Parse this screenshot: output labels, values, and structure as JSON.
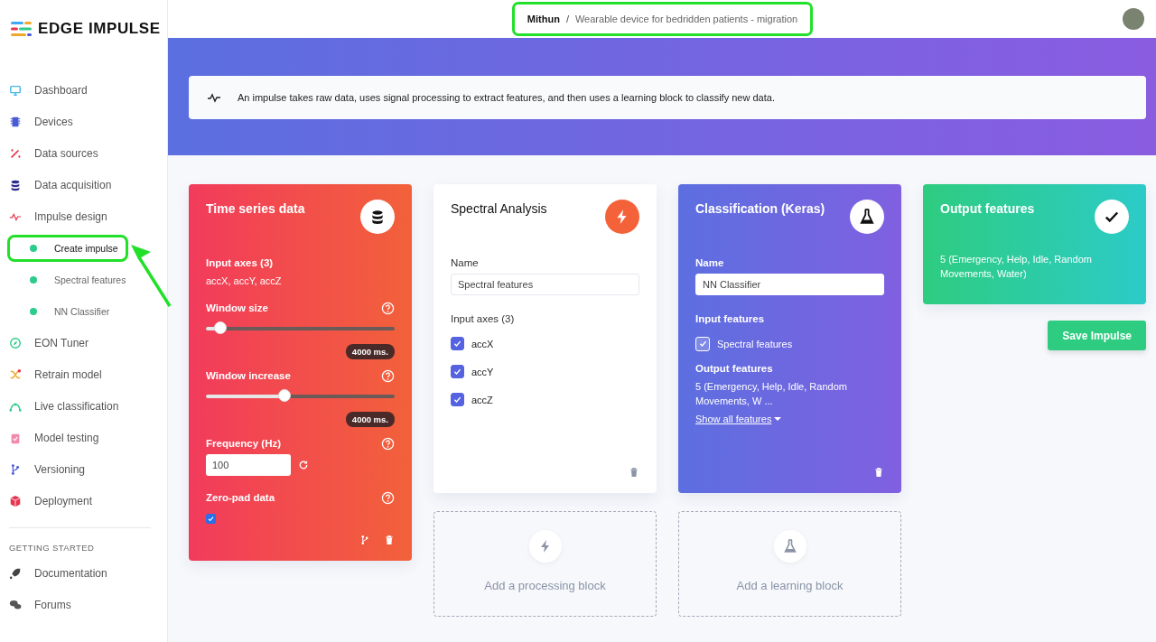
{
  "brand": {
    "name": "EDGE IMPULSE"
  },
  "sidebar": {
    "items": [
      {
        "label": "Dashboard",
        "selected": false
      },
      {
        "label": "Devices",
        "selected": false
      },
      {
        "label": "Data sources",
        "selected": false
      },
      {
        "label": "Data acquisition",
        "selected": false
      },
      {
        "label": "Impulse design",
        "selected": false,
        "children": [
          {
            "label": "Create impulse",
            "selected": true,
            "highlighted": true
          },
          {
            "label": "Spectral features",
            "selected": false,
            "highlighted": false
          },
          {
            "label": "NN Classifier",
            "selected": false,
            "highlighted": false
          }
        ]
      },
      {
        "label": "EON Tuner",
        "selected": false
      },
      {
        "label": "Retrain model",
        "selected": false
      },
      {
        "label": "Live classification",
        "selected": false
      },
      {
        "label": "Model testing",
        "selected": false
      },
      {
        "label": "Versioning",
        "selected": false
      },
      {
        "label": "Deployment",
        "selected": false
      }
    ],
    "section_title": "GETTING STARTED",
    "links": [
      {
        "label": "Documentation"
      },
      {
        "label": "Forums"
      }
    ]
  },
  "breadcrumb": {
    "owner": "Mithun",
    "separator": "/",
    "project": "Wearable device for bedridden patients - migration",
    "highlighted": true
  },
  "info": {
    "text": "An impulse takes raw data, uses signal processing to extract features, and then uses a learning block to classify new data."
  },
  "columns": [
    {
      "items": [
        {
          "kind": "input",
          "title": "Time series data",
          "axes_label": "Input axes (3)",
          "axes_value": "accX, accY, accZ",
          "sliders": [
            {
              "label": "Window size",
              "level": 0.08,
              "reading": "4000 ms."
            },
            {
              "label": "Window increase",
              "level": 0.42,
              "reading": "4000 ms."
            }
          ],
          "frequency": {
            "label": "Frequency (Hz)",
            "value": "100"
          },
          "zero_pad": {
            "label": "Zero-pad data",
            "checked": true
          }
        }
      ]
    },
    {
      "items": [
        {
          "kind": "processing",
          "title": "Spectral Analysis",
          "name_label": "Name",
          "name_value": "Spectral features",
          "axes_label": "Input axes (3)",
          "axes": [
            {
              "label": "accX",
              "checked": true
            },
            {
              "label": "accY",
              "checked": true
            },
            {
              "label": "accZ",
              "checked": true
            }
          ]
        },
        {
          "kind": "add",
          "label": "Add a processing block"
        }
      ]
    },
    {
      "items": [
        {
          "kind": "learning",
          "title": "Classification (Keras)",
          "name_label": "Name",
          "name_value": "NN Classifier",
          "input_label": "Input features",
          "inputs": [
            {
              "label": "Spectral features",
              "checked": true
            }
          ],
          "output_label": "Output features",
          "output_value": "5 (Emergency, Help, Idle, Random Movements, W ...",
          "link": "Show all features"
        },
        {
          "kind": "add",
          "label": "Add a learning block"
        }
      ]
    },
    {
      "items": [
        {
          "kind": "output",
          "title": "Output features",
          "value": "5 (Emergency, Help, Idle, Random Movements, Water)"
        },
        {
          "kind": "button",
          "label": "Save Impulse"
        }
      ]
    }
  ]
}
